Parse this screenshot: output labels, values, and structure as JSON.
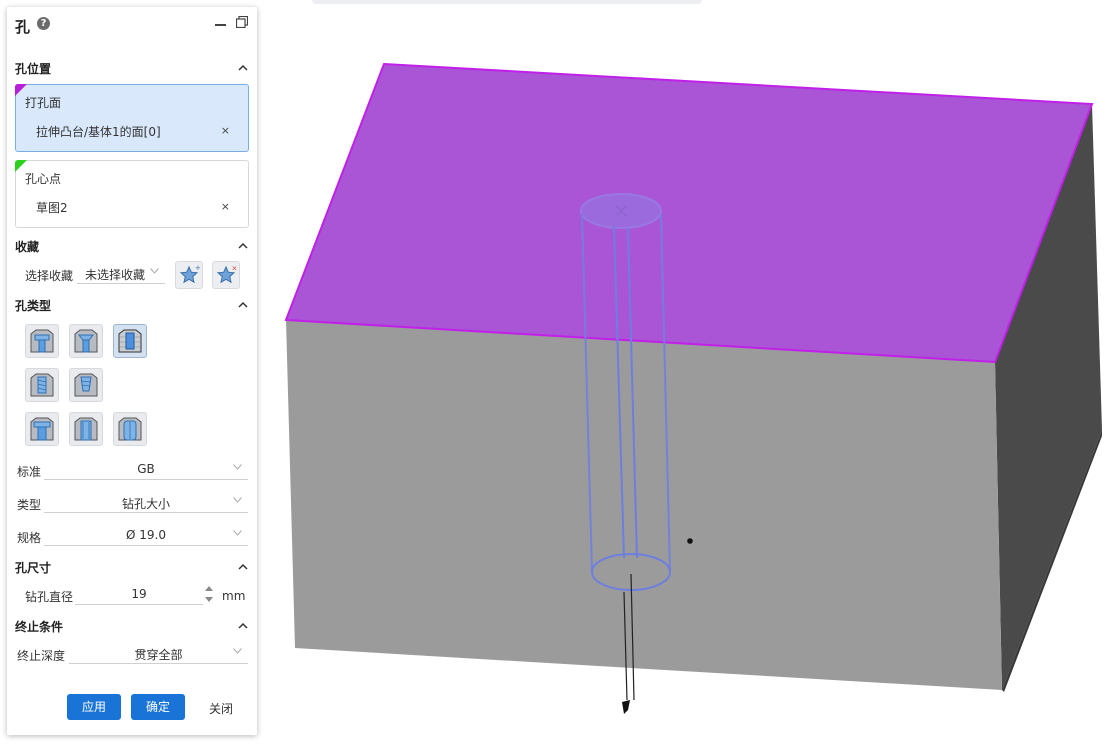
{
  "dialog": {
    "title": "孔",
    "help_icon": "question-circle-icon",
    "minimize_icon": "minimize-icon",
    "restore_icon": "restore-window-icon"
  },
  "hole_position": {
    "title": "孔位置",
    "face_label": "打孔面",
    "face_value": "拉伸凸台/基体1的面[0]",
    "center_label": "孔心点",
    "center_value": "草图2",
    "clear_symbol": "×"
  },
  "favorites": {
    "title": "收藏",
    "select_label": "选择收藏",
    "select_value": "未选择收藏"
  },
  "hole_type": {
    "title": "孔类型",
    "standard_label": "标准",
    "standard_value": "GB",
    "type_label": "类型",
    "type_value": "钻孔大小",
    "spec_label": "规格",
    "spec_value": "Ø 19.0"
  },
  "hole_size": {
    "title": "孔尺寸",
    "drill_diameter_label": "钻孔直径",
    "drill_diameter_value": "19",
    "unit": "mm"
  },
  "end_condition": {
    "title": "终止条件",
    "depth_label": "终止深度",
    "depth_value": "贯穿全部"
  },
  "actions": {
    "apply": "应用",
    "ok": "确定",
    "close": "关闭"
  },
  "colors": {
    "accent": "#1a73d6",
    "top_face": "#a955d6",
    "face_edge": "#c020e8",
    "hole_outline": "#6c7fe0",
    "block_front": "#9b9b9b",
    "block_side": "#4a4a4a"
  }
}
